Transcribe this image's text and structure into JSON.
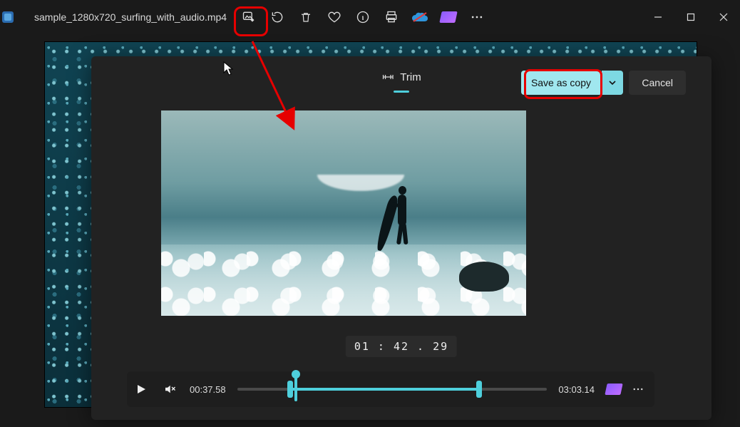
{
  "title": "sample_1280x720_surfing_with_audio.mp4",
  "toolbar": {
    "edit_icon": "image-edit-icon",
    "rotate_icon": "rotate-icon",
    "delete_icon": "trash-icon",
    "favorite_icon": "heart-icon",
    "info_icon": "info-icon",
    "print_icon": "print-icon",
    "onedrive_icon": "onedrive-icon",
    "clipchamp_icon": "clipchamp-icon",
    "more_icon": "more-icon"
  },
  "window": {
    "minimize": "minimize",
    "maximize": "maximize",
    "close": "close"
  },
  "trim": {
    "title": "Trim",
    "save_label": "Save as copy",
    "cancel_label": "Cancel",
    "timecode": "01 : 42 . 29"
  },
  "playbar": {
    "play": "play",
    "mute": "mute",
    "current_time": "00:37.58",
    "total_time": "03:03.14",
    "trim_start_pct": 17,
    "trim_end_pct": 78,
    "playhead_pct": 19
  }
}
